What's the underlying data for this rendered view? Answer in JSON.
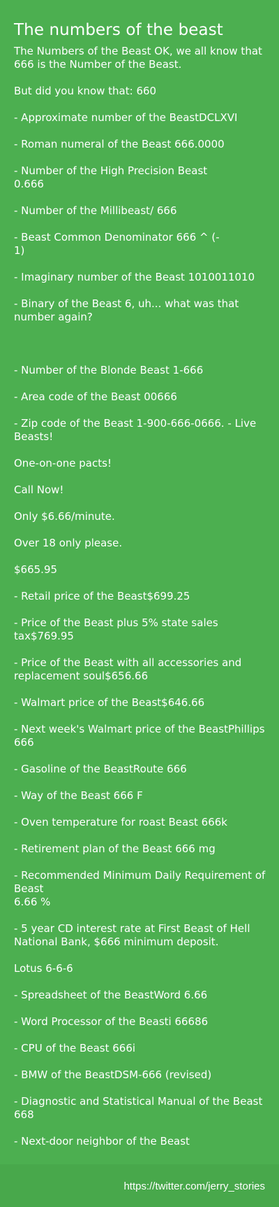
{
  "title": "The numbers of the beast",
  "body": "The Numbers of the Beast OK, we all know that 666 is the Number of the Beast.\n\nBut did you know that: 660\n\n- Approximate number of the BeastDCLXVI\n\n- Roman numeral of the Beast 666.0000\n\n- Number of the High Precision Beast\n0.666\n\n- Number of the Millibeast/ 666\n\n- Beast Common Denominator 666 ^ (-\n1)\n\n- Imaginary number of the Beast 1010011010\n\n- Binary of the Beast 6, uh... what was that number again?\n\n\n\n- Number of the Blonde Beast 1-666\n\n- Area code of the Beast 00666\n\n- Zip code of the Beast 1-900-666-0666. - Live Beasts!\n\nOne-on-one pacts!\n\nCall Now!\n\nOnly $6.66/minute.\n\nOver 18 only please.\n\n$665.95\n\n- Retail price of the Beast$699.25\n\n- Price of the Beast plus 5% state sales tax$769.95\n\n- Price of the Beast with all accessories and replacement soul$656.66\n\n- Walmart price of the Beast$646.66\n\n- Next week's Walmart price of the BeastPhillips 666\n\n- Gasoline of the BeastRoute 666\n\n- Way of the Beast 666 F\n\n- Oven temperature for roast Beast 666k\n\n- Retirement plan of the Beast 666 mg\n\n- Recommended Minimum Daily Requirement of Beast\n6.66 %\n\n- 5 year CD interest rate at First Beast of Hell National Bank, $666 minimum deposit.\n\nLotus 6-6-6\n\n- Spreadsheet of the BeastWord 6.66\n\n- Word Processor of the Beasti 66686\n\n- CPU of the Beast 666i\n\n- BMW of the BeastDSM-666 (revised)\n\n- Diagnostic and Statistical Manual of the Beast 668\n\n- Next-door neighbor of the Beast",
  "footer": {
    "link": "https://twitter.com/jerry_stories"
  },
  "colors": {
    "background": "#4caf50",
    "footer_background": "#48a84b",
    "text": "#ffffff"
  }
}
